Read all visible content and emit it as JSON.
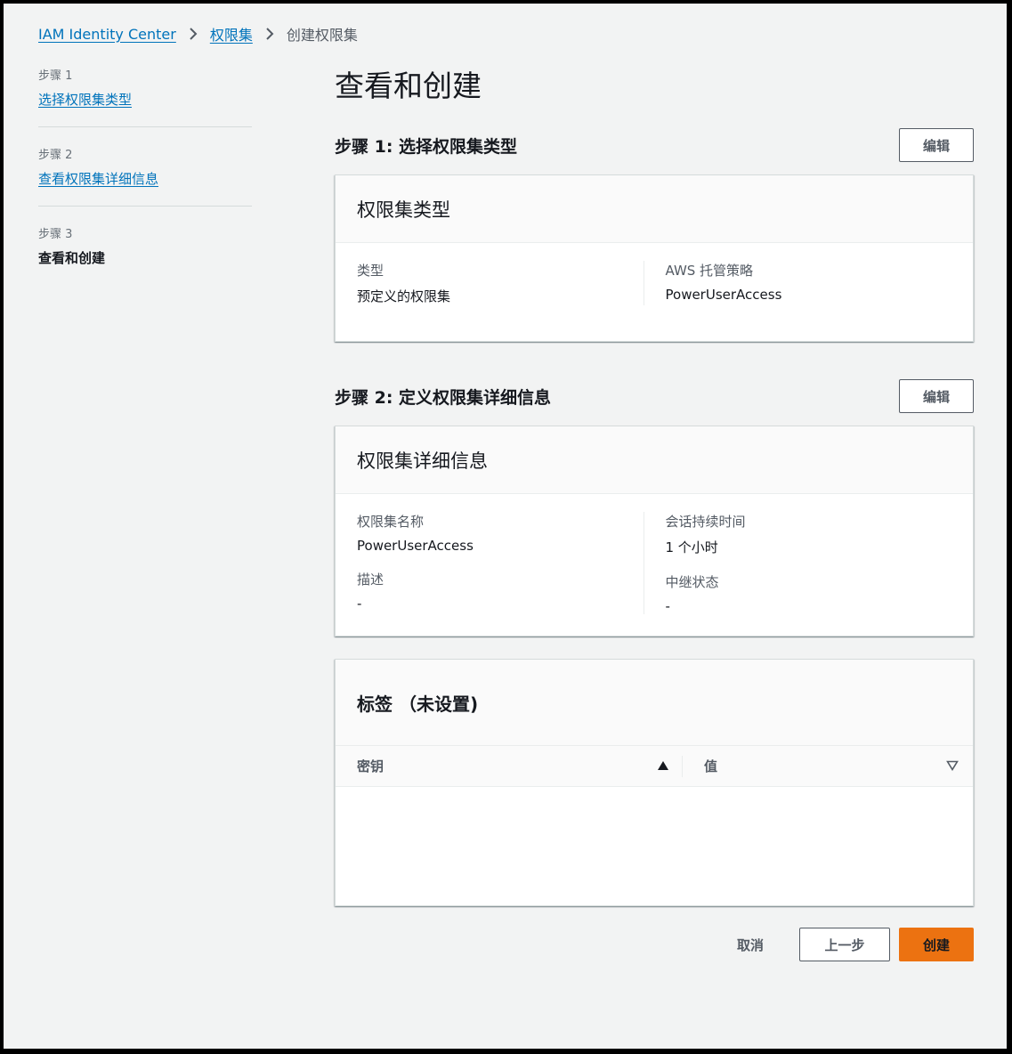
{
  "breadcrumb": {
    "items": [
      "IAM Identity Center",
      "权限集",
      "创建权限集"
    ]
  },
  "steps": [
    {
      "number": "步骤 1",
      "title": "选择权限集类型"
    },
    {
      "number": "步骤 2",
      "title": "查看权限集详细信息"
    },
    {
      "number": "步骤 3",
      "title": "查看和创建"
    }
  ],
  "page": {
    "title": "查看和创建"
  },
  "section1": {
    "title": "步骤 1: 选择权限集类型",
    "edit_label": "编辑",
    "card_title": "权限集类型",
    "fields": [
      {
        "label": "类型",
        "value": "预定义的权限集"
      },
      {
        "label": "AWS 托管策略",
        "value": "PowerUserAccess"
      }
    ]
  },
  "section2": {
    "title": "步骤 2: 定义权限集详细信息",
    "edit_label": "编辑",
    "card_title": "权限集详细信息",
    "fields": [
      {
        "label": "权限集名称",
        "value": "PowerUserAccess"
      },
      {
        "label": "会话持续时间",
        "value": "1 个小时"
      },
      {
        "label": "描述",
        "value": "-"
      },
      {
        "label": "中继状态",
        "value": "-"
      }
    ]
  },
  "tags": {
    "title": "标签 （未设置)",
    "columns": [
      "密钥",
      "值"
    ]
  },
  "actions": {
    "cancel": "取消",
    "previous": "上一步",
    "create": "创建"
  },
  "colors": {
    "link": "#0073bb",
    "primary": "#ec7211",
    "background": "#f2f3f3"
  }
}
